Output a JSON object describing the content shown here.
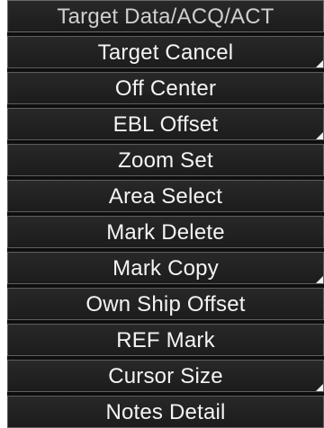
{
  "menu": {
    "items": [
      {
        "label": "Target Data/ACQ/ACT",
        "header": true,
        "submenu": false
      },
      {
        "label": "Target Cancel",
        "header": false,
        "submenu": true
      },
      {
        "label": "Off Center",
        "header": false,
        "submenu": false
      },
      {
        "label": "EBL Offset",
        "header": false,
        "submenu": true
      },
      {
        "label": "Zoom Set",
        "header": false,
        "submenu": false
      },
      {
        "label": "Area Select",
        "header": false,
        "submenu": false
      },
      {
        "label": "Mark Delete",
        "header": false,
        "submenu": false
      },
      {
        "label": "Mark Copy",
        "header": false,
        "submenu": true
      },
      {
        "label": "Own Ship Offset",
        "header": false,
        "submenu": false
      },
      {
        "label": "REF Mark",
        "header": false,
        "submenu": false
      },
      {
        "label": "Cursor Size",
        "header": false,
        "submenu": true
      },
      {
        "label": "Notes Detail",
        "header": false,
        "submenu": false
      }
    ]
  }
}
